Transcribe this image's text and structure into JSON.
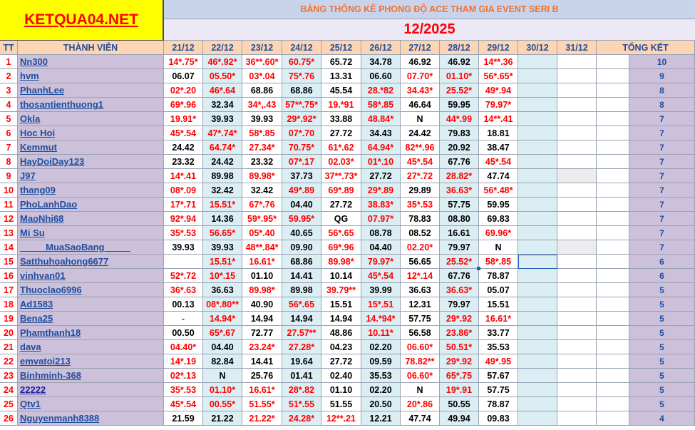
{
  "logo_text": "KETQUA04.NET",
  "banner_title": "BẢNG THỐNG KÊ PHONG ĐỘ ACE THAM GIA EVENT SERI B",
  "month_label": "12/2025",
  "headers": {
    "tt": "TT",
    "member": "THÀNH VIÊN",
    "dates": [
      "21/12",
      "22/12",
      "23/12",
      "24/12",
      "25/12",
      "26/12",
      "27/12",
      "28/12",
      "29/12",
      "30/12",
      "31/12"
    ],
    "total": "TỔNG KẾT"
  },
  "colors": {
    "red": "#ff0000",
    "blue": "#1f4e9f",
    "yellow": "#ffff00",
    "header_peach": "#fcd5b4",
    "name_lilac": "#ccc0da"
  },
  "rows": [
    {
      "tt": "1",
      "name": "Nn300",
      "values": [
        "14*.75*",
        "46*.92*",
        "36**.60*",
        "60.75*",
        "65.72",
        "34.78",
        "46.92",
        "46.92",
        "14**.36"
      ],
      "total": "10"
    },
    {
      "tt": "2",
      "name": "hvm",
      "values": [
        "06.07",
        "05.50*",
        "03*.04",
        "75*.76",
        "13.31",
        "06.60",
        "07.70*",
        "01.10*",
        "56*.65*"
      ],
      "total": "9"
    },
    {
      "tt": "3",
      "name": "PhanhLee",
      "values": [
        "02*.20",
        "46*.64",
        "68.86",
        "68.86",
        "45.54",
        "28.*82",
        "34.43*",
        "25.52*",
        "49*.94"
      ],
      "total": "8"
    },
    {
      "tt": "4",
      "name": "thosantienthuong1",
      "values": [
        "69*.96",
        "32.34",
        "34*,.43",
        "57**.75*",
        "19.*91",
        "58*.85",
        "46.64",
        "59.95",
        "79.97*"
      ],
      "total": "8"
    },
    {
      "tt": "5",
      "name": "Okla",
      "values": [
        "19.91*",
        "39.93",
        "39.93",
        "29*.92*",
        "33.88",
        "48.84*",
        "N",
        "44*.99",
        "14**.41"
      ],
      "total": "7"
    },
    {
      "tt": "6",
      "name": "Hoc Hoi",
      "values": [
        "45*.54",
        "47*.74*",
        "58*.85",
        "07*.70",
        "27.72",
        "34.43",
        "24.42",
        "79.83",
        "18.81"
      ],
      "total": "7"
    },
    {
      "tt": "7",
      "name": "Kemmut",
      "values": [
        "24.42",
        "64.74*",
        "27.34*",
        "70.75*",
        "61*.62",
        "64.94*",
        "82**.96",
        "20.92",
        "38.47"
      ],
      "total": "7"
    },
    {
      "tt": "8",
      "name": "HayDoiDay123",
      "values": [
        "23.32",
        "24.42",
        "23.32",
        "07*.17",
        "02.03*",
        "01*.10",
        "45*.54",
        "67.76",
        "45*.54"
      ],
      "total": "7"
    },
    {
      "tt": "9",
      "name": "J97",
      "values": [
        "14*.41",
        "89.98",
        "89.98*",
        "37.73",
        "37**.73*",
        "27.72",
        "27*.72",
        "28.82*",
        "47.74"
      ],
      "total": "7"
    },
    {
      "tt": "10",
      "name": "thang09",
      "values": [
        "08*.09",
        "32.42",
        "32.42",
        "49*.89",
        "69*.89",
        "29*.89",
        "29.89",
        "36.63*",
        "56*.48*"
      ],
      "total": "7"
    },
    {
      "tt": "11",
      "name": "PhoLanhDao",
      "values": [
        "17*.71",
        "15.51*",
        "67*.76",
        "04.40",
        "27.72",
        "38.83*",
        "35*.53",
        "57.75",
        "59.95"
      ],
      "total": "7"
    },
    {
      "tt": "12",
      "name": "MaoNhi68",
      "values": [
        "92*.94",
        "14.36",
        "59*.95*",
        "59.95*",
        "QG",
        "07.97*",
        "78.83",
        "08.80",
        "69.83"
      ],
      "total": "7"
    },
    {
      "tt": "13",
      "name": "Mi Su",
      "values": [
        "35*.53",
        "56.65*",
        "05*.40",
        "40.65",
        "56*.65",
        "08.78",
        "08.52",
        "16.61",
        "69.96*"
      ],
      "total": "7"
    },
    {
      "tt": "14",
      "name": "_____MuaSaoBang_____",
      "values": [
        "39.93",
        "39.93",
        "48**.84*",
        "09.90",
        "69*.96",
        "04.40",
        "02.20*",
        "79.97",
        "N"
      ],
      "total": "7"
    },
    {
      "tt": "15",
      "name": "Satthuhoahong6677",
      "values": [
        "",
        "15.51*",
        "16.61*",
        "68.86",
        "89.98*",
        "79.97*",
        "56.65",
        "25.52*",
        "58*.85"
      ],
      "total": "6"
    },
    {
      "tt": "16",
      "name": "vinhvan01",
      "values": [
        "52*.72",
        "10*.15",
        "01.10",
        "14.41",
        "10.14",
        "45*.54",
        "12*.14",
        "67.76",
        "78.87"
      ],
      "total": "6"
    },
    {
      "tt": "17",
      "name": "Thuoclao6996",
      "values": [
        "36*.63",
        "36.63",
        "89.98*",
        "89.98",
        "39.79**",
        "39.99",
        "36.63",
        "36.63*",
        "05.07"
      ],
      "total": "5"
    },
    {
      "tt": "18",
      "name": "Ad1583",
      "values": [
        "00.13",
        "08*.80**",
        "40.90",
        "56*.65",
        "15.51",
        "15*.51",
        "12.31",
        "79.97",
        "15.51"
      ],
      "total": "5"
    },
    {
      "tt": "19",
      "name": "Bena25",
      "values": [
        "-",
        "14.94*",
        "14.94",
        "14.94",
        "14.94",
        "14.*94*",
        "57.75",
        "29*.92",
        "16.61*"
      ],
      "total": "5"
    },
    {
      "tt": "20",
      "name": "Phamthanh18",
      "values": [
        "00.50",
        "65*.67",
        "72.77",
        "27.57**",
        "48.86",
        "10.11*",
        "56.58",
        "23.86*",
        "33.77"
      ],
      "total": "5"
    },
    {
      "tt": "21",
      "name": "dava",
      "values": [
        "04.40*",
        "04.40",
        "23.24*",
        "27.28*",
        "04.23",
        "02.20",
        "06.60*",
        "50.51*",
        "35.53"
      ],
      "total": "5"
    },
    {
      "tt": "22",
      "name": "emvatoi213",
      "values": [
        "14*.19",
        "82.84",
        "14.41",
        "19.64",
        "27.72",
        "09.59",
        "78.82**",
        "29*.92",
        "49*.95"
      ],
      "total": "5"
    },
    {
      "tt": "23",
      "name": "Binhminh-368",
      "values": [
        "02*.13",
        "N",
        "25.76",
        "01.41",
        "02.40",
        "35.53",
        "06.60*",
        "65*.75",
        "57.67"
      ],
      "total": "5"
    },
    {
      "tt": "24",
      "name": "22222",
      "values": [
        "35*.53",
        "01.10*",
        "16.61*",
        "28*.82",
        "01.10",
        "02.20",
        "N",
        "19*.91",
        "57.75"
      ],
      "total": "5"
    },
    {
      "tt": "25",
      "name": "Qtv1",
      "values": [
        "45*.54",
        "00.55*",
        "51.55*",
        "51*.55",
        "51.55",
        "20.50",
        "20*.86",
        "50.55",
        "78.87"
      ],
      "total": "5"
    },
    {
      "tt": "26",
      "name": "Nguyenmanh8388",
      "values": [
        "21.59",
        "21.22",
        "21.22*",
        "24.28*",
        "12**.21",
        "12.21",
        "47.74",
        "49.94",
        "09.83"
      ],
      "total": "4"
    }
  ]
}
